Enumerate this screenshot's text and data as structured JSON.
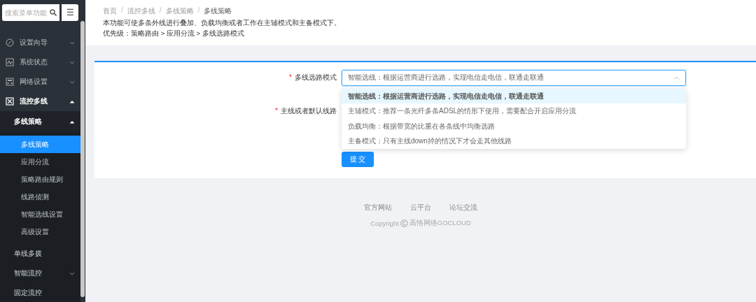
{
  "sidebar": {
    "search": {
      "placeholder": "搜索菜单功能"
    },
    "menu_button": "☰",
    "items": [
      {
        "label": "设置向导",
        "expanded": false
      },
      {
        "label": "系统状态",
        "expanded": false
      },
      {
        "label": "网络设置",
        "expanded": false
      },
      {
        "label": "流控多线",
        "expanded": true,
        "children": [
          {
            "label": "多线策略",
            "expanded": true,
            "children": [
              {
                "label": "多线策略",
                "selected": true
              },
              {
                "label": "应用分流",
                "selected": false
              },
              {
                "label": "策略路由规则",
                "selected": false
              },
              {
                "label": "线路侦测",
                "selected": false
              },
              {
                "label": "智能选线设置",
                "selected": false
              },
              {
                "label": "高级设置",
                "selected": false
              }
            ]
          },
          {
            "label": "单线多拨",
            "selected": false
          },
          {
            "label": "智能流控",
            "expanded": false
          },
          {
            "label": "固定流控",
            "selected": false
          }
        ]
      }
    ]
  },
  "breadcrumb": {
    "separator": "/",
    "items": [
      "首页",
      "流控多线",
      "多线策略",
      "多线策略"
    ]
  },
  "description": [
    "本功能可使多条外线进行叠加、负载均衡或者工作在主辅模式和主备模式下。",
    "优先级：策略路由 > 应用分流 > 多线选路模式"
  ],
  "form": {
    "required_mark": "*",
    "fields": [
      {
        "label": "多线选路模式",
        "required": true,
        "value": "智能选线：根据运营商进行选路，实现电信走电信，联通走联通",
        "expanded": true,
        "options": [
          {
            "label": "智能选线：根据运营商进行选路，实现电信走电信，联通走联通",
            "selected": true
          },
          {
            "label": "主辅模式：推荐一条光纤多条ADSL的情形下使用，需要配合开启应用分流",
            "selected": false
          },
          {
            "label": "负载均衡：根据带宽的比重在各条线中均衡选路",
            "selected": false
          },
          {
            "label": "主备模式：只有主线down掉的情况下才会走其他线路",
            "selected": false
          }
        ]
      },
      {
        "label": "主线或者默认线路",
        "required": true
      }
    ],
    "submit": "提 交"
  },
  "footer": {
    "links": [
      "官方网站",
      "云平台",
      "论坛交流"
    ],
    "copyright": "Copyright",
    "copyright_owner": "高恪网络GOCLOUD"
  }
}
